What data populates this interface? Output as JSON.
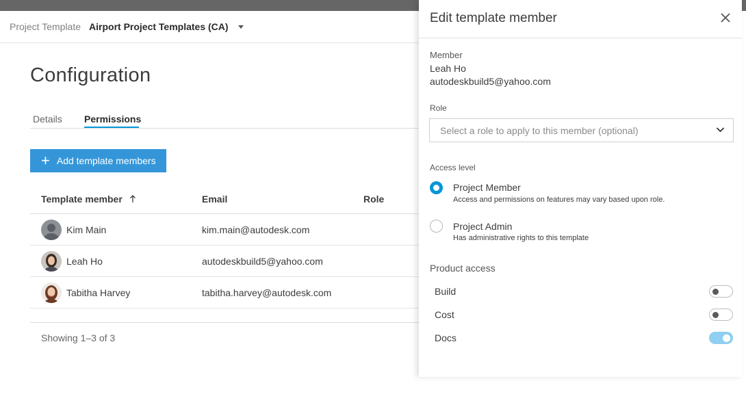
{
  "header": {
    "breadcrumb_label": "Project Template",
    "project_name": "Airport Project Templates (CA)"
  },
  "page": {
    "title": "Configuration",
    "tabs": [
      {
        "label": "Details",
        "active": false
      },
      {
        "label": "Permissions",
        "active": true
      }
    ],
    "add_button_label": "Add template members"
  },
  "table": {
    "columns": [
      "Template member",
      "Email",
      "Role"
    ],
    "rows": [
      {
        "name": "Kim Main",
        "email": "kim.main@autodesk.com",
        "role": "",
        "avatar": "generic-user-avatar"
      },
      {
        "name": "Leah Ho",
        "email": "autodeskbuild5@yahoo.com",
        "role": "",
        "avatar": "user-photo-avatar"
      },
      {
        "name": "Tabitha Harvey",
        "email": "tabitha.harvey@autodesk.com",
        "role": "",
        "avatar": "user-photo-avatar"
      }
    ],
    "footer": "Showing 1–3 of 3"
  },
  "panel": {
    "title": "Edit template member",
    "member_label": "Member",
    "member_name": "Leah Ho",
    "member_email": "autodeskbuild5@yahoo.com",
    "role_label": "Role",
    "role_placeholder": "Select a role to apply to this member (optional)",
    "access_label": "Access level",
    "access_options": [
      {
        "title": "Project Member",
        "desc": "Access and permissions on features may vary based upon role.",
        "checked": true
      },
      {
        "title": "Project Admin",
        "desc": "Has administrative rights to this template",
        "checked": false
      }
    ],
    "product_access_label": "Product access",
    "products": [
      {
        "label": "Build",
        "enabled": false
      },
      {
        "label": "Cost",
        "enabled": false
      },
      {
        "label": "Docs",
        "enabled": true
      }
    ]
  },
  "colors": {
    "accent": "#0696d7",
    "button": "#3496d9",
    "toggle_on": "#8fcff1"
  }
}
